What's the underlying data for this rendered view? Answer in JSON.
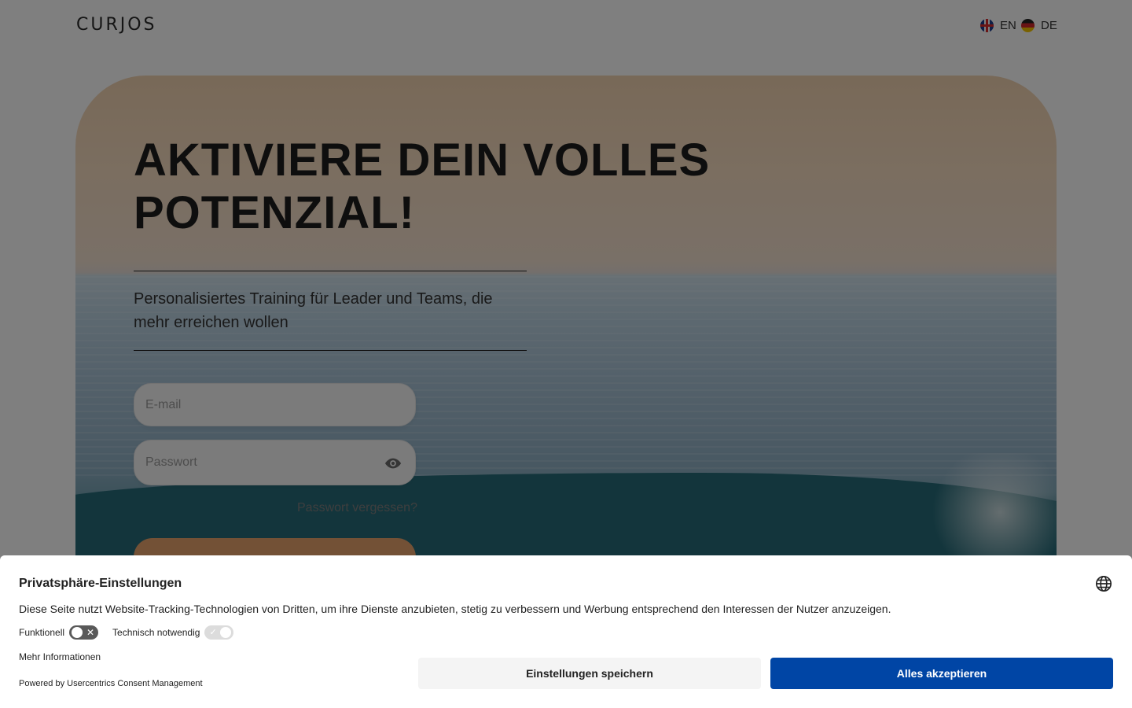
{
  "header": {
    "logo": "CURJOS",
    "languages": [
      {
        "code": "EN",
        "flag": "uk-flag-icon"
      },
      {
        "code": "DE",
        "flag": "germany-flag-icon"
      }
    ]
  },
  "hero": {
    "headline": "AKTIVIERE DEIN VOLLES POTENZIAL!",
    "subtitle": "Personalisiertes Training für Leader und Teams, die mehr erreichen wollen"
  },
  "login": {
    "email_placeholder": "E-mail",
    "password_placeholder": "Passwort",
    "forgot_password": "Passwort vergessen?",
    "button_color": "#e7a26c"
  },
  "consent": {
    "title": "Privatsphäre-Einstellungen",
    "description": "Diese Seite nutzt Website-Tracking-Technologien von Dritten, um ihre Dienste anzubieten, stetig zu verbessern und Werbung entsprechend den Interessen der Nutzer anzuzeigen.",
    "toggles": [
      {
        "label": "Funktionell",
        "state": "off"
      },
      {
        "label": "Technisch notwendig",
        "state": "on-disabled"
      }
    ],
    "more_info": "Mehr Informationen",
    "powered_by": "Powered by Usercentrics Consent Management",
    "save_button": "Einstellungen speichern",
    "accept_button": "Alles akzeptieren",
    "accept_color": "#0045a5"
  }
}
